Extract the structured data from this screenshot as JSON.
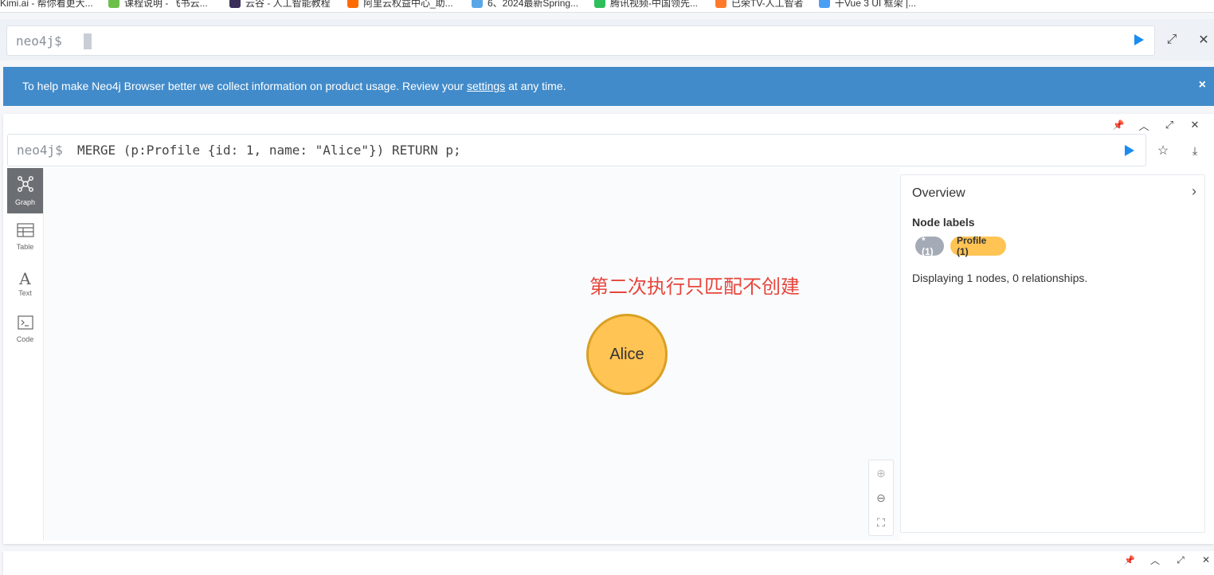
{
  "bookmarks": [
    {
      "label": "Kimi.ai - 帮你看更大..."
    },
    {
      "label": "课程说明 - 飞书云..."
    },
    {
      "label": "云谷 - 人工智能教程"
    },
    {
      "label": "阿里云权益中心_助..."
    },
    {
      "label": "6、2024最新Spring..."
    },
    {
      "label": "腾讯视频-中国领先..."
    },
    {
      "label": "已荣TV-人工智者"
    },
    {
      "label": "干Vue 3 UI 框架 |..."
    }
  ],
  "top_editor": {
    "prompt": "neo4j$",
    "value": ""
  },
  "banner": {
    "text_before": "To help make Neo4j Browser better we collect information on product usage. Review your ",
    "link": "settings",
    "text_after": " at any time.",
    "close": "×"
  },
  "frame": {
    "prompt": "neo4j$",
    "query": "MERGE (p:Profile {id: 1, name: \"Alice\"}) RETURN p;",
    "tabs": [
      {
        "label": "Graph",
        "icon": "graph-icon"
      },
      {
        "label": "Table",
        "icon": "table-icon"
      },
      {
        "label": "Text",
        "icon": "text-icon"
      },
      {
        "label": "Code",
        "icon": "code-icon"
      }
    ],
    "annotation": "第二次执行只匹配不创建",
    "node": {
      "caption": "Alice",
      "color": "#ffc454",
      "border": "#d9a022"
    },
    "overview": {
      "title": "Overview",
      "section": "Node labels",
      "labels": [
        {
          "text": "* (1)",
          "color": "#a5abb6"
        },
        {
          "text": "Profile (1)",
          "color": "#ffc454"
        }
      ],
      "status": "Displaying 1 nodes, 0 relationships."
    }
  },
  "colors": {
    "accent": "#1a8cf0",
    "banner": "#428bca",
    "annotation": "#e8453c"
  }
}
